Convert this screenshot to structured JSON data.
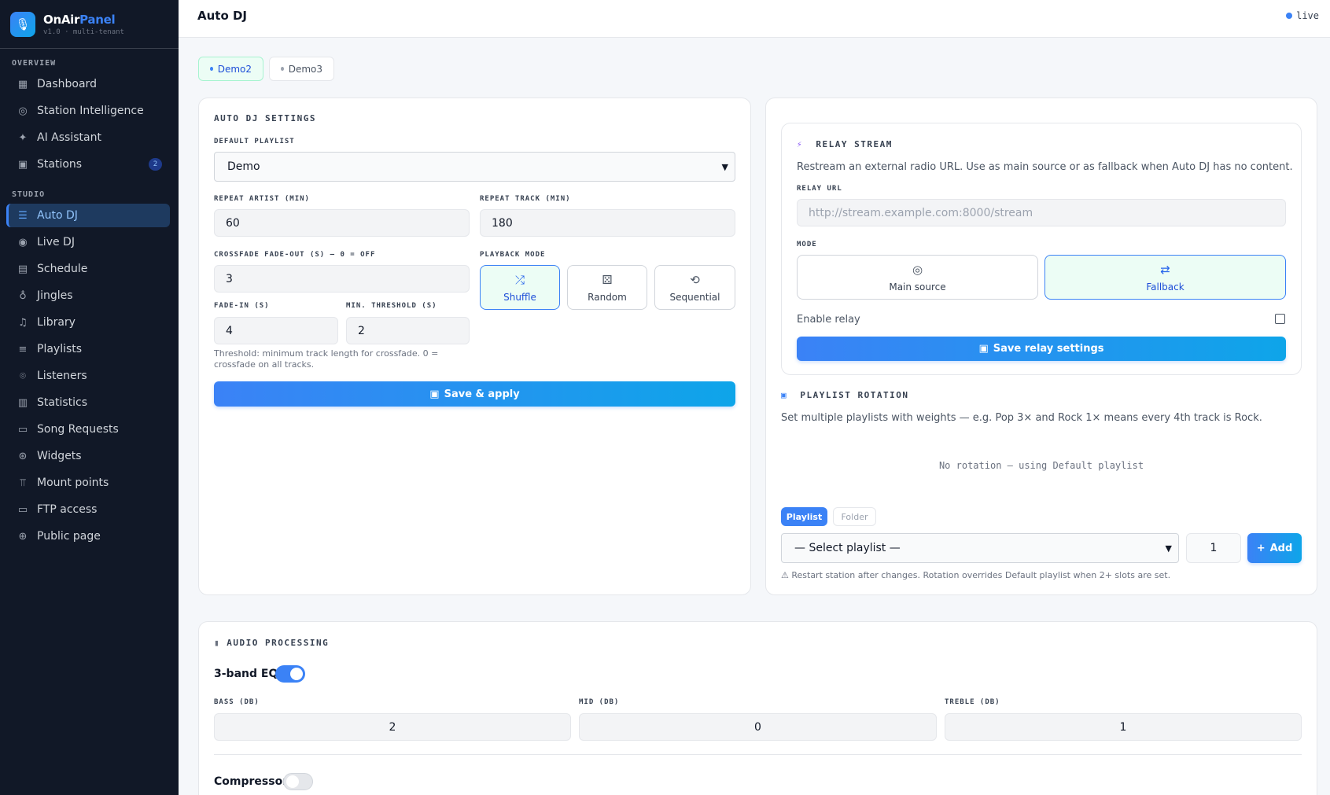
{
  "brand": {
    "name_main": "OnAir",
    "name_accent": "Panel",
    "subtitle": "v1.0 · multi-tenant",
    "logo_icon": "mic-icon"
  },
  "sidebar": {
    "section_overview": "OVERVIEW",
    "section_studio": "STUDIO",
    "items": [
      {
        "label": "Dashboard",
        "icon": "grid-icon"
      },
      {
        "label": "Station Intelligence",
        "icon": "brain-icon"
      },
      {
        "label": "AI Assistant",
        "icon": "sparkles-icon"
      },
      {
        "label": "Stations",
        "icon": "calendar-icon",
        "badge": "2"
      },
      {
        "label": "Auto DJ",
        "icon": "sliders-icon",
        "active": true
      },
      {
        "label": "Live DJ",
        "icon": "broadcast-icon"
      },
      {
        "label": "Schedule",
        "icon": "calendar-icon"
      },
      {
        "label": "Jingles",
        "icon": "mic-icon"
      },
      {
        "label": "Library",
        "icon": "music-icon"
      },
      {
        "label": "Playlists",
        "icon": "list-music-icon"
      },
      {
        "label": "Listeners",
        "icon": "location-pin-icon"
      },
      {
        "label": "Statistics",
        "icon": "bar-chart-icon"
      },
      {
        "label": "Song Requests",
        "icon": "message-icon"
      },
      {
        "label": "Widgets",
        "icon": "widget-icon"
      },
      {
        "label": "Mount points",
        "icon": "antenna-icon"
      },
      {
        "label": "FTP access",
        "icon": "server-icon"
      },
      {
        "label": "Public page",
        "icon": "globe-icon"
      }
    ]
  },
  "topbar": {
    "title": "Auto DJ",
    "status": "live"
  },
  "station_tabs": [
    "Demo2",
    "Demo3"
  ],
  "autodj": {
    "title": "AUTO DJ SETTINGS",
    "default_playlist_label": "DEFAULT PLAYLIST",
    "default_playlist_value": "Demo",
    "repeat_artist_label": "REPEAT ARTIST (MIN)",
    "repeat_artist_value": "60",
    "repeat_track_label": "REPEAT TRACK (MIN)",
    "repeat_track_value": "180",
    "crossfade_label": "CROSSFADE FADE-OUT (S) — 0 = OFF",
    "crossfade_value": "3",
    "playback_mode_label": "PLAYBACK MODE",
    "modes": [
      {
        "label": "Shuffle",
        "icon": "shuffle-icon",
        "active": true
      },
      {
        "label": "Random",
        "icon": "dice-icon"
      },
      {
        "label": "Sequential",
        "icon": "repeat-icon"
      }
    ],
    "fade_in_label": "FADE-IN (S)",
    "fade_in_value": "4",
    "threshold_label": "MIN. THRESHOLD (S)",
    "threshold_value": "2",
    "threshold_hint": "Threshold: minimum track length for crossfade. 0 = crossfade on all tracks.",
    "save_label": "Save & apply"
  },
  "relay": {
    "title": "RELAY STREAM",
    "description": "Restream an external radio URL. Use as main source or as fallback when Auto DJ has no content.",
    "url_label": "RELAY URL",
    "url_placeholder": "http://stream.example.com:8000/stream",
    "mode_label": "MODE",
    "modes": [
      {
        "label": "Main source",
        "icon": "radio-icon"
      },
      {
        "label": "Fallback",
        "icon": "swap-icon",
        "active": true
      }
    ],
    "enable_label": "Enable relay",
    "enabled": false,
    "save_label": "Save relay settings"
  },
  "rotation": {
    "title": "PLAYLIST ROTATION",
    "description": "Set multiple playlists with weights — e.g. Pop 3× and Rock 1× means every 4th track is Rock.",
    "empty_text": "No rotation — using Default playlist",
    "tab_playlist": "Playlist",
    "tab_folder": "Folder",
    "select_value": "— Select playlist —",
    "weight_value": "1",
    "add_label": "Add",
    "note": "⚠ Restart station after changes. Rotation overrides Default playlist when 2+ slots are set."
  },
  "audio": {
    "title": "AUDIO PROCESSING",
    "eq_label": "3-band EQ",
    "eq_enabled": true,
    "bass_label": "BASS (DB)",
    "bass_value": "2",
    "mid_label": "MID (DB)",
    "mid_value": "0",
    "treble_label": "TREBLE (DB)",
    "treble_value": "1",
    "compressor_label": "Compressor",
    "compressor_enabled": false
  }
}
